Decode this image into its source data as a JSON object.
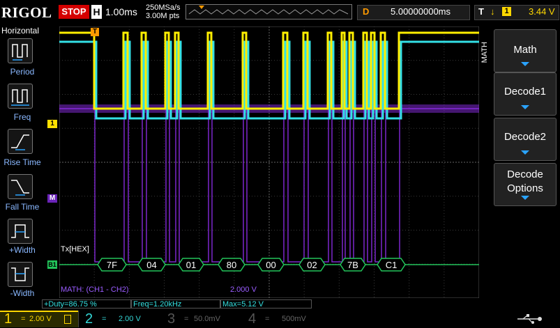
{
  "header": {
    "brand": "RIGOL",
    "run_state": "STOP",
    "horizontal_key": "H",
    "timebase": "1.00ms",
    "sample_rate": "250MSa/s",
    "memory_depth": "3.00M pts",
    "delay_label": "D",
    "delay_value": "5.00000000ms",
    "trigger_label": "T",
    "trigger_source": "1",
    "trigger_level": "3.44 V"
  },
  "left_panel": {
    "title": "Horizontal",
    "items": [
      {
        "label": "Period",
        "icon": "period-icon"
      },
      {
        "label": "Freq",
        "icon": "frequency-icon"
      },
      {
        "label": "Rise Time",
        "icon": "rise-time-icon"
      },
      {
        "label": "Fall Time",
        "icon": "fall-time-icon"
      },
      {
        "label": "+Width",
        "icon": "positive-width-icon"
      },
      {
        "label": "-Width",
        "icon": "negative-width-icon"
      }
    ]
  },
  "right_panel": {
    "vertical_label": "MATH",
    "softkeys": [
      {
        "label": "Math"
      },
      {
        "label": "Decode1"
      },
      {
        "label": "Decode2"
      },
      {
        "label": "Decode Options"
      }
    ]
  },
  "scope": {
    "markers": {
      "ch1": "1",
      "math": "M",
      "bus": "B1",
      "trigger": "T"
    },
    "decode_label": "Tx[HEX]",
    "decode_bytes": [
      "7F",
      "04",
      "01",
      "80",
      "00",
      "02",
      "7B",
      "C1"
    ],
    "math_label": "MATH:  (CH1 - CH2)",
    "math_scale": "2.000 V"
  },
  "measurements": [
    {
      "text": "+Duty=86.75 %"
    },
    {
      "text": "Freq=1.20kHz"
    },
    {
      "text": "Max=5.12 V"
    }
  ],
  "channels": [
    {
      "num": "1",
      "coupling": "=",
      "scale": "2.00 V",
      "color": "#ffd800",
      "active": true
    },
    {
      "num": "2",
      "coupling": "=",
      "scale": "2.00 V",
      "color": "#33d6d6",
      "active": true
    },
    {
      "num": "3",
      "coupling": "=",
      "scale": "50.0mV",
      "color": "#d648d6",
      "active": false
    },
    {
      "num": "4",
      "coupling": "=",
      "scale": "500mV",
      "color": "#2a6bff",
      "active": false
    }
  ],
  "colors": {
    "ch1": "#ffee00",
    "ch2": "#33e0e6",
    "math": "#8a2be2",
    "bus": "#22c45a",
    "stop": "#d40000"
  }
}
